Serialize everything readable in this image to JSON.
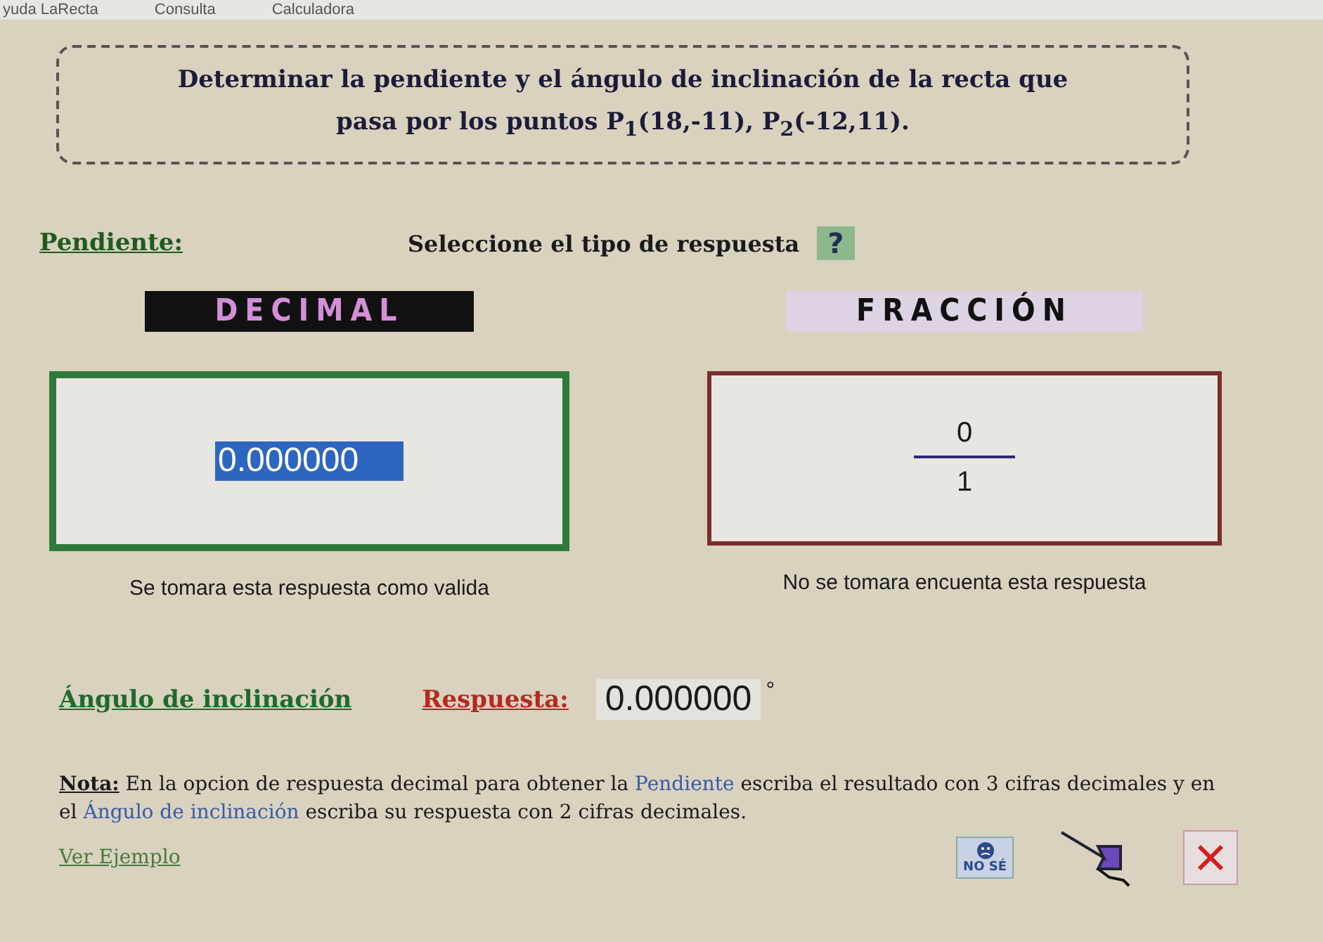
{
  "menu": [
    "yuda LaRecta",
    "Consulta",
    "Calculadora"
  ],
  "problem": "Determinar la pendiente y el ángulo de inclinación de la recta que pasa por los puntos P$_{1}$(18,-11), P$_{2}$(-12,11).",
  "slope_label": "Pendiente:",
  "prompt": "Seleccione el tipo de respuesta",
  "help_button": "?",
  "answer_types": [
    {
      "kind": "decimal",
      "label": "DECIMAL",
      "selected": true,
      "value": "0.000000",
      "note": "Se tomara esta respuesta como valida"
    },
    {
      "kind": "fraction",
      "label": "FRACCIÓN",
      "selected": false,
      "numerator": "0",
      "denominator": "1",
      "note": "No se tomara encuenta esta respuesta"
    }
  ],
  "angle_label": "Ángulo de inclinación",
  "answer_label": "Respuesta:",
  "angle_value": "0.000000",
  "degree_sign": "°",
  "note": [
    {
      "kind": "label",
      "text": "Nota:"
    },
    {
      "kind": "plain",
      "text": " En la opcion de respuesta decimal para obtener la "
    },
    {
      "kind": "term",
      "text": "Pendiente"
    },
    {
      "kind": "plain",
      "text": " escriba el resultado con 3 cifras  decimales y  en el "
    },
    {
      "kind": "term",
      "text": "Ángulo de inclinación"
    },
    {
      "kind": "plain",
      "text": " escriba  su respuesta con 2 cifras decimales."
    }
  ],
  "example_link": "Ver Ejemplo",
  "dont_know_button": "NO SÉ"
}
